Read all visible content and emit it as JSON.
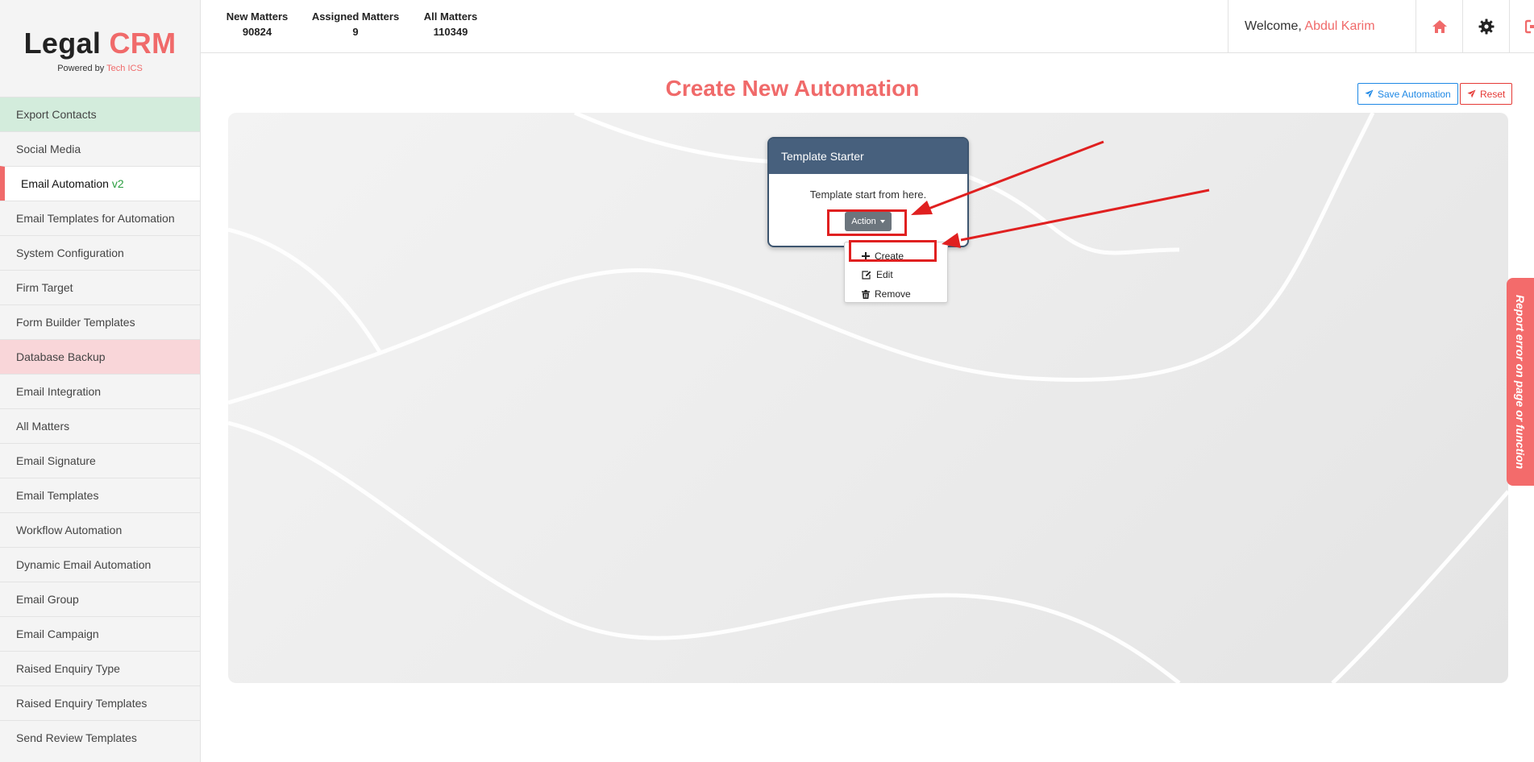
{
  "brand": {
    "title_main": "Legal",
    "title_accent": "CRM",
    "powered_prefix": "Powered by",
    "powered_by": "Tech ICS"
  },
  "sidebar": {
    "items": [
      {
        "label": "Export Contacts"
      },
      {
        "label": "Social Media"
      },
      {
        "label": "Email Automation",
        "badge": "v2"
      },
      {
        "label": "Email Templates for Automation"
      },
      {
        "label": "System Configuration"
      },
      {
        "label": "Firm Target"
      },
      {
        "label": "Form Builder Templates"
      },
      {
        "label": "Database Backup"
      },
      {
        "label": "Email Integration"
      },
      {
        "label": "All Matters"
      },
      {
        "label": "Email Signature"
      },
      {
        "label": "Email Templates"
      },
      {
        "label": "Workflow Automation"
      },
      {
        "label": "Dynamic Email Automation"
      },
      {
        "label": "Email Group"
      },
      {
        "label": "Email Campaign"
      },
      {
        "label": "Raised Enquiry Type"
      },
      {
        "label": "Raised Enquiry Templates"
      },
      {
        "label": "Send Review Templates"
      }
    ]
  },
  "header": {
    "stats": [
      {
        "label": "New Matters",
        "value": "90824"
      },
      {
        "label": "Assigned Matters",
        "value": "9"
      },
      {
        "label": "All Matters",
        "value": "110349"
      }
    ],
    "welcome_prefix": "Welcome,",
    "user_name": "Abdul Karim",
    "icons": [
      "home-icon",
      "gear-icon",
      "logout-icon"
    ]
  },
  "main": {
    "title": "Create New Automation",
    "save_label": "Save Automation",
    "reset_label": "Reset",
    "node": {
      "title": "Template Starter",
      "text": "Template start from here.",
      "action_label": "Action"
    },
    "dropdown": {
      "create": "Create",
      "edit": "Edit",
      "remove": "Remove"
    }
  },
  "report_tab": "Report error on page or function",
  "colors": {
    "accent": "#f06a6a",
    "node_header": "#47607d",
    "save_blue": "#1e88e5",
    "reset_red": "#e53935",
    "annotation_red": "#e02020"
  }
}
